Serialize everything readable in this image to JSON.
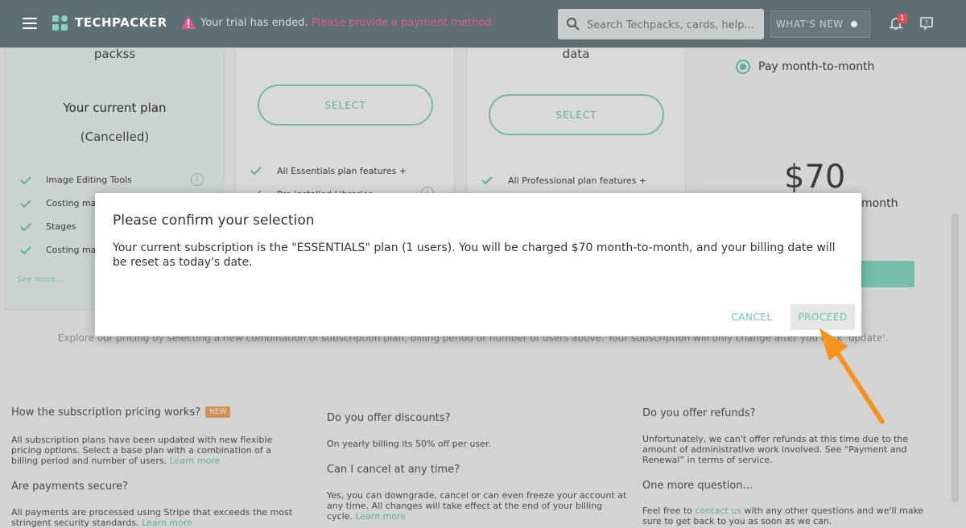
{
  "topbar": {
    "logo_text": "TECHPACKER",
    "trial_text": "Your trial has ended.",
    "trial_link": "Please provide a payment method.",
    "search_placeholder": "Search Techpacks, cards, help...",
    "whats_new": "WHAT'S NEW",
    "notification_count": "1"
  },
  "plans": {
    "current": {
      "name_tail": "packss",
      "label": "Your current plan",
      "status": "(Cancelled)",
      "features": [
        "Image Editing Tools",
        "Costing ma",
        "Stages",
        "Costing ma"
      ],
      "see_more": "See more..."
    },
    "plan2": {
      "select": "SELECT",
      "features": [
        "All Essentials plan features +",
        "Pre-installed Libraries"
      ]
    },
    "plan3": {
      "name_tail": "data",
      "select": "SELECT",
      "features": [
        "All Professional plan features +"
      ]
    },
    "summary": {
      "billing_option": "Pay month-to-month",
      "price": "$70",
      "per": "month"
    }
  },
  "explore_text": "Explore our pricing by selecting a new combination of subscription plan, billing period or number of users above. Your subscription will only change after you click 'update'.",
  "faq": {
    "q1": "How the subscription pricing works?",
    "q1_badge": "NEW",
    "a1": "All subscription plans have been updated with new flexible pricing options. Select a base plan with a combination of a billing period and number of users.",
    "a1_link": "Learn more",
    "q2": "Are payments secure?",
    "a2": "All payments are processed using Stripe that exceeds the most stringent security standards.",
    "a2_link": "Learn more",
    "q3": "Do you offer discounts?",
    "a3": "On yearly billing its 50% off per user.",
    "q4": "Can I cancel at any time?",
    "a4": "Yes, you can downgrade, cancel or can even freeze your account at any time. All changes will take effect at the end of your billing cycle.",
    "a4_link": "Learn more",
    "q5": "Do you offer refunds?",
    "a5": "Unfortunately, we can't offer refunds at this time due to the amount of administrative work involved. See “Payment and Renewal” in terms of service.",
    "q6": "One more question...",
    "a6_pre": "Feel free to",
    "a6_link": "contact us",
    "a6_post": "with any other questions and we'll make sure to get back to you as soon as we can."
  },
  "dialog": {
    "title": "Please confirm your selection",
    "body": "Your current subscription is the \"ESSENTIALS\" plan (1 users). You will be charged $70 month-to-month, and your billing date will be reset as today's date.",
    "cancel": "CANCEL",
    "proceed": "PROCEED"
  },
  "colors": {
    "topbar": "#5d6f75",
    "accent": "#6cc8b4",
    "trial_link": "#e05a8a",
    "arrow": "#f7941d"
  }
}
